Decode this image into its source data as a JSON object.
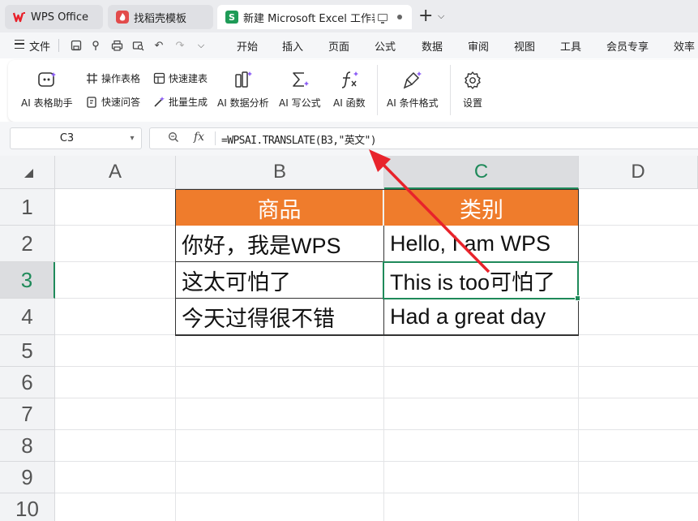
{
  "tabs": [
    {
      "label": "WPS Office",
      "icon": "wps-logo-icon"
    },
    {
      "label": "找稻壳模板",
      "icon": "daoke-icon"
    },
    {
      "label": "新建 Microsoft Excel 工作表.",
      "icon": "excel-sheet-icon",
      "active": true
    }
  ],
  "menu": {
    "file_label": "文件",
    "items": [
      "开始",
      "插入",
      "页面",
      "公式",
      "数据",
      "审阅",
      "视图",
      "工具",
      "会员专享",
      "效率"
    ]
  },
  "ribbon": {
    "ai_table_assistant": "AI 表格助手",
    "operate_table": "操作表格",
    "quick_qa": "快速问答",
    "quick_build_table": "快速建表",
    "batch_generate": "批量生成",
    "ai_data_analysis": "AI 数据分析",
    "ai_write_formula": "AI 写公式",
    "ai_function": "AI 函数",
    "ai_conditional_format": "AI 条件格式",
    "settings": "设置"
  },
  "formula_bar": {
    "name_box": "C3",
    "fx_label": "fx",
    "formula": "=WPSAI.TRANSLATE(B3,\"英文\")"
  },
  "sheet": {
    "columns": [
      "A",
      "B",
      "C",
      "D"
    ],
    "active_column": "C",
    "rows": [
      "1",
      "2",
      "3",
      "4",
      "5",
      "6",
      "7",
      "8",
      "9",
      "10"
    ],
    "active_row": "3",
    "active_cell": "C3",
    "header_fill_color": "#ef7c2c",
    "selection_color": "#1f8a5a",
    "table": {
      "headers": [
        "商品",
        "类别"
      ],
      "rows": [
        [
          "你好，我是WPS",
          "Hello, I am WPS"
        ],
        [
          "这太可怕了",
          "This is too可怕了"
        ],
        [
          "今天过得很不错",
          "Had a great day"
        ]
      ]
    }
  },
  "annotation_arrow_color": "#e8232b"
}
